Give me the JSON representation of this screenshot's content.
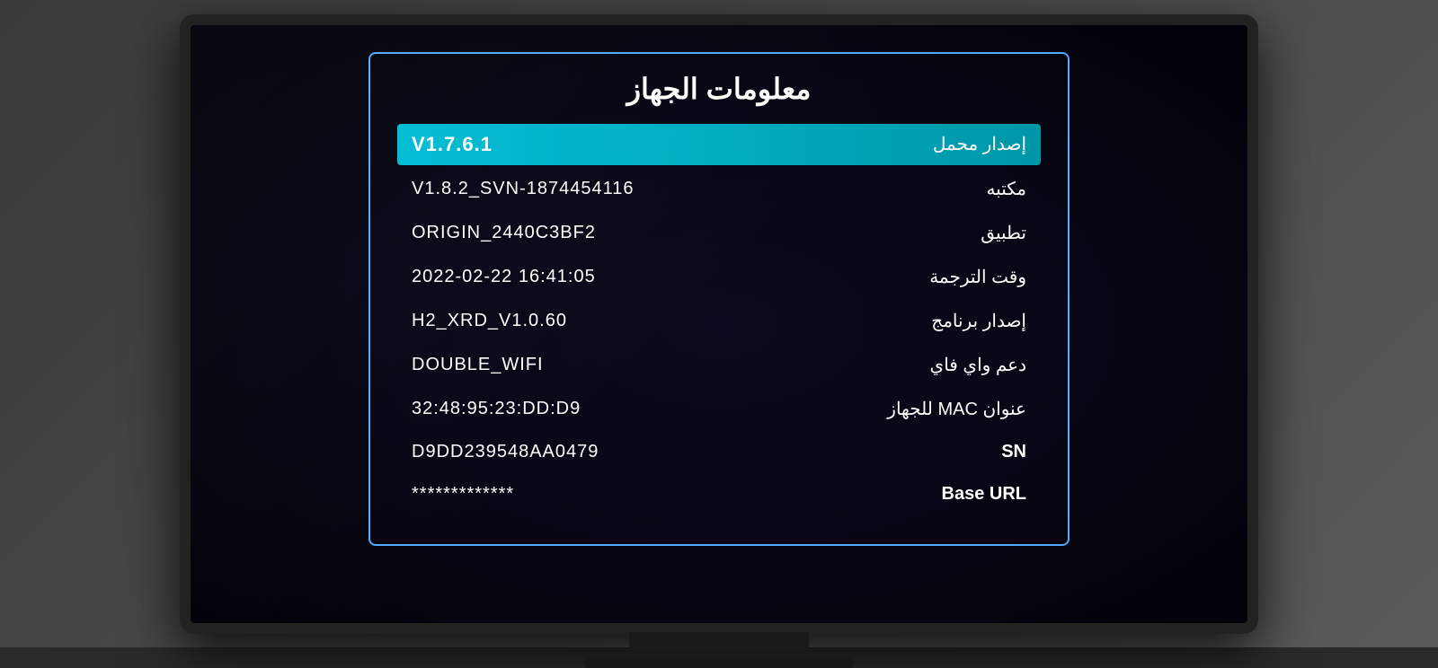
{
  "panel": {
    "title": "معلومات الجهاز",
    "rows": [
      {
        "label": "إصدار محمل",
        "value": "V1.7.6.1",
        "highlighted": true,
        "label_ltr": false
      },
      {
        "label": "مكتبه",
        "value": "V1.8.2_SVN-1874454116",
        "highlighted": false,
        "label_ltr": false
      },
      {
        "label": "تطبيق",
        "value": "ORIGIN_2440C3BF2",
        "highlighted": false,
        "label_ltr": false
      },
      {
        "label": "وقت الترجمة",
        "value": "2022-02-22 16:41:05",
        "highlighted": false,
        "label_ltr": false
      },
      {
        "label": "إصدار برنامج",
        "value": "H2_XRD_V1.0.60",
        "highlighted": false,
        "label_ltr": false
      },
      {
        "label": "دعم واي فاي",
        "value": "DOUBLE_WIFI",
        "highlighted": false,
        "label_ltr": false
      },
      {
        "label": "عنوان MAC للجهاز",
        "value": "32:48:95:23:DD:D9",
        "highlighted": false,
        "label_ltr": false
      },
      {
        "label": "SN",
        "value": "D9DD239548AA0479",
        "highlighted": false,
        "label_ltr": true
      },
      {
        "label": "Base URL",
        "value": "*************",
        "highlighted": false,
        "label_ltr": true
      }
    ]
  }
}
